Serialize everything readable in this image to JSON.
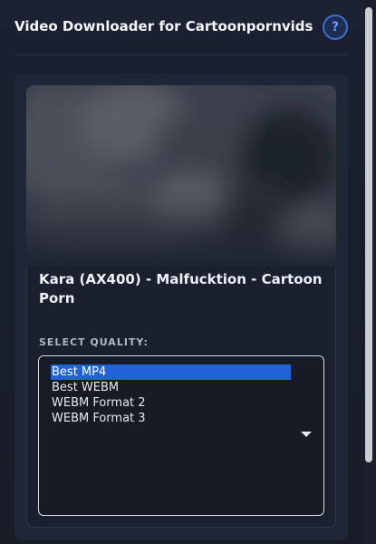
{
  "header": {
    "title": "Video Downloader for Cartoonpornvids",
    "help_label": "?"
  },
  "video": {
    "title": "Kara (AX400) - Malfucktion - Cartoon Porn",
    "thumbnail_icon": "blurred-thumbnail-image"
  },
  "quality": {
    "label": "SELECT QUALITY:",
    "selected_index": 0,
    "options": [
      {
        "label": "Best MP4"
      },
      {
        "label": "Best WEBM"
      },
      {
        "label": "WEBM Format 2"
      },
      {
        "label": "WEBM Format 3"
      }
    ]
  },
  "colors": {
    "background": "#1b2130",
    "accent": "#1f63d6",
    "help_ring": "#3d6ed6"
  }
}
